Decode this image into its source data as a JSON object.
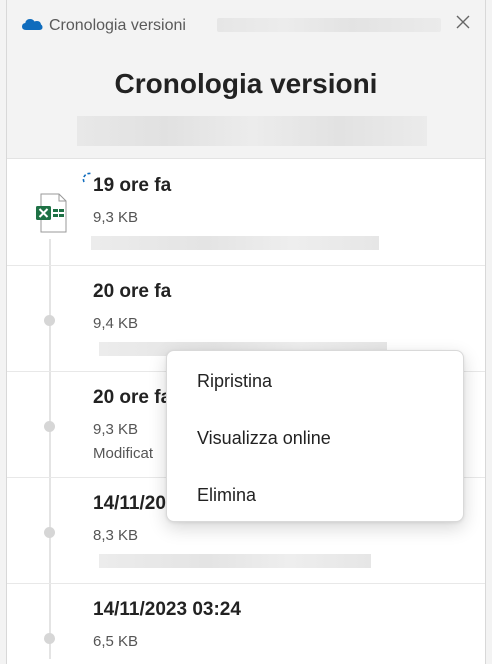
{
  "titlebar": {
    "title": "Cronologia versioni",
    "close_icon": "close-icon",
    "app_icon": "onedrive-cloud-icon"
  },
  "header": {
    "title": "Cronologia versioni"
  },
  "versions": [
    {
      "time": "19 ore fa",
      "size": "9,3 KB",
      "author": "",
      "file_icon": "excel-file-icon"
    },
    {
      "time": "20 ore fa",
      "size": "9,4 KB",
      "author": ""
    },
    {
      "time": "20 ore fa",
      "size": "9,3 KB",
      "author": "Modificat"
    },
    {
      "time": "14/11/20",
      "size": "8,3 KB",
      "author": ""
    },
    {
      "time": "14/11/2023 03:24",
      "size": "6,5 KB",
      "author": ""
    }
  ],
  "context_menu": {
    "items": [
      {
        "label": "Ripristina"
      },
      {
        "label": "Visualizza online"
      },
      {
        "label": "Elimina"
      }
    ]
  },
  "colors": {
    "excel_green": "#1e7145",
    "onedrive_blue": "#0f6cbd",
    "accent_spinner": "#0f6cbd"
  }
}
